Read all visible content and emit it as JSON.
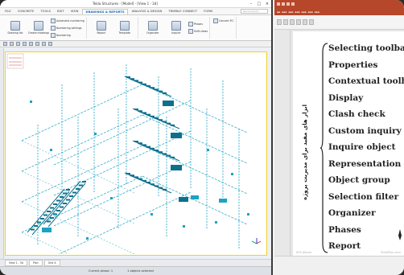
{
  "tekla": {
    "title": "Tekla Structures - [Model] - [View 1 - 3d]",
    "tabs": [
      "FILE",
      "CONCRETE",
      "TOOLS",
      "EDIT",
      "VIEW",
      "DRAWINGS & REPORTS",
      "ANALYSIS & DESIGN",
      "TRIMBLE CONNECT",
      "FORM"
    ],
    "active_tab": "DRAWINGS & REPORTS",
    "search_placeholder": "Quick launch",
    "ribbon": {
      "group1": [
        "Drawing list",
        "Create drawings"
      ],
      "group1_small": [
        "Automatic numbering",
        "Numbering settings",
        "Numbering"
      ],
      "group2": [
        "Report",
        "Template"
      ],
      "group3": [
        "Organizer",
        "Inquire"
      ],
      "group3_small": [
        "Phases",
        "Shift views"
      ],
      "group4_small": [
        "Convert IFC"
      ]
    },
    "view_tabs": [
      "View 1 - 3d",
      "Plan",
      "Grid A"
    ],
    "status": [
      "Current phase: 1",
      "1 objects selected"
    ],
    "colors": {
      "structure": "#1aa3c4",
      "structure_dark": "#0e6f8c",
      "accent": "#f2d02a"
    }
  },
  "ppt": {
    "menu_items": [
      "Selecting toolbar",
      "Properties",
      "Contextual toolbar",
      "Display",
      "Clash check",
      "Custom inquiry",
      "Inquire object",
      "Representation",
      "Object group",
      "Selection filter",
      "Organizer",
      "Phases",
      "Report"
    ],
    "vertical_label": "ابزار های مفید برای مدیریت پروژه",
    "footer_left": "M.R.Akbari",
    "footer_right": "TeklaPlus.com",
    "colors": {
      "brand": "#b7472a"
    }
  }
}
